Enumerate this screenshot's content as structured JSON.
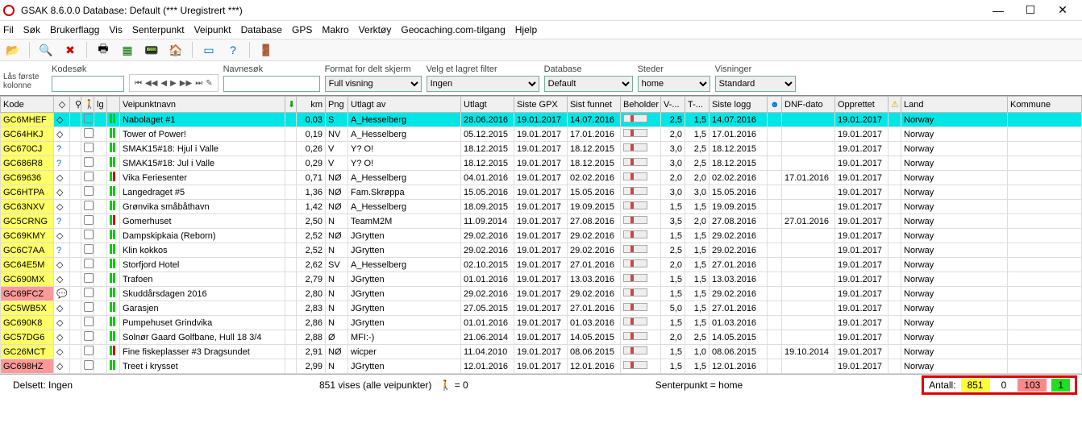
{
  "window": {
    "title": "GSAK 8.6.0.0   Database: Default  (*** Uregistrert ***)"
  },
  "menu": [
    "Fil",
    "Søk",
    "Brukerflagg",
    "Vis",
    "Senterpunkt",
    "Veipunkt",
    "Database",
    "GPS",
    "Makro",
    "Verktøy",
    "Geocaching.com-tilgang",
    "Hjelp"
  ],
  "filters": {
    "lock_col": "Lås første\nkolonne",
    "kodesok_label": "Kodesøk",
    "kodesok_value": "",
    "navnesok_label": "Navnesøk",
    "navnesok_value": "",
    "format_label": "Format for delt skjerm",
    "format_value": "Full visning",
    "filter_label": "Velg et lagret filter",
    "filter_value": "Ingen",
    "database_label": "Database",
    "database_value": "Default",
    "steder_label": "Steder",
    "steder_value": "home",
    "visninger_label": "Visninger",
    "visninger_value": "Standard"
  },
  "columns": [
    "Kode",
    "",
    "",
    "",
    "lg",
    "",
    "Veipunktnavn",
    "",
    "km",
    "Png",
    "Utlagt av",
    "Utlagt",
    "Siste GPX",
    "Sist funnet",
    "Beholder",
    "V-...",
    "T-...",
    "Siste logg",
    "",
    "DNF-dato",
    "Opprettet",
    "",
    "Land",
    "Kommune"
  ],
  "rows": [
    {
      "kode": "GC6MHEF",
      "sel": true,
      "navn": "Nabolaget #1",
      "km": "0,03",
      "png": "S",
      "av": "A_Hesselberg",
      "utlagt": "28.06.2016",
      "gpx": "19.01.2017",
      "funnet": "14.07.2016",
      "v": "2,5",
      "t": "1,5",
      "logg": "14.07.2016",
      "dnf": "",
      "oppr": "19.01.2017",
      "land": "Norway"
    },
    {
      "kode": "GC64HKJ",
      "navn": "Tower of Power!",
      "km": "0,19",
      "png": "NV",
      "av": "A_Hesselberg",
      "utlagt": "05.12.2015",
      "gpx": "19.01.2017",
      "funnet": "17.01.2016",
      "v": "2,0",
      "t": "1,5",
      "logg": "17.01.2016",
      "dnf": "",
      "oppr": "19.01.2017",
      "land": "Norway"
    },
    {
      "kode": "GC670CJ",
      "q": true,
      "navn": "SMAK15#18: Hjul i Valle",
      "km": "0,26",
      "png": "V",
      "av": "Y? O!",
      "utlagt": "18.12.2015",
      "gpx": "19.01.2017",
      "funnet": "18.12.2015",
      "v": "3,0",
      "t": "2,5",
      "logg": "18.12.2015",
      "dnf": "",
      "oppr": "19.01.2017",
      "land": "Norway"
    },
    {
      "kode": "GC686R8",
      "q": true,
      "navn": "SMAK15#18: Jul i Valle",
      "km": "0,29",
      "png": "V",
      "av": "Y? O!",
      "utlagt": "18.12.2015",
      "gpx": "19.01.2017",
      "funnet": "18.12.2015",
      "v": "3,0",
      "t": "2,5",
      "logg": "18.12.2015",
      "dnf": "",
      "oppr": "19.01.2017",
      "land": "Norway"
    },
    {
      "kode": "GC69636",
      "red": false,
      "flagr": true,
      "navn": "Vika Feriesenter",
      "km": "0,71",
      "png": "NØ",
      "av": "A_Hesselberg",
      "utlagt": "04.01.2016",
      "gpx": "19.01.2017",
      "funnet": "02.02.2016",
      "v": "2,0",
      "t": "2,0",
      "logg": "02.02.2016",
      "dnf": "17.01.2016",
      "oppr": "19.01.2017",
      "land": "Norway"
    },
    {
      "kode": "GC6HTPA",
      "navn": "Langedraget #5",
      "km": "1,36",
      "png": "NØ",
      "av": "Fam.Skrøppa",
      "utlagt": "15.05.2016",
      "gpx": "19.01.2017",
      "funnet": "15.05.2016",
      "v": "3,0",
      "t": "3,0",
      "logg": "15.05.2016",
      "dnf": "",
      "oppr": "19.01.2017",
      "land": "Norway"
    },
    {
      "kode": "GC63NXV",
      "navn": "Grønvika småbåthavn",
      "km": "1,42",
      "png": "NØ",
      "av": "A_Hesselberg",
      "utlagt": "18.09.2015",
      "gpx": "19.01.2017",
      "funnet": "19.09.2015",
      "v": "1,5",
      "t": "1,5",
      "logg": "19.09.2015",
      "dnf": "",
      "oppr": "19.01.2017",
      "land": "Norway"
    },
    {
      "kode": "GC5CRNG",
      "q": true,
      "flagr": true,
      "navn": "Gomerhuset",
      "km": "2,50",
      "png": "N",
      "av": "TeamM2M",
      "utlagt": "11.09.2014",
      "gpx": "19.01.2017",
      "funnet": "27.08.2016",
      "v": "3,5",
      "t": "2,0",
      "logg": "27.08.2016",
      "dnf": "27.01.2016",
      "oppr": "19.01.2017",
      "land": "Norway"
    },
    {
      "kode": "GC69KMY",
      "navn": "Dampskipkaia (Reborn)",
      "km": "2,52",
      "png": "NØ",
      "av": "JGrytten",
      "utlagt": "29.02.2016",
      "gpx": "19.01.2017",
      "funnet": "29.02.2016",
      "v": "1,5",
      "t": "1,5",
      "logg": "29.02.2016",
      "dnf": "",
      "oppr": "19.01.2017",
      "land": "Norway"
    },
    {
      "kode": "GC6C7AA",
      "q": true,
      "navn": "Klin kokkos",
      "km": "2,52",
      "png": "N",
      "av": "JGrytten",
      "utlagt": "29.02.2016",
      "gpx": "19.01.2017",
      "funnet": "29.02.2016",
      "v": "2,5",
      "t": "1,5",
      "logg": "29.02.2016",
      "dnf": "",
      "oppr": "19.01.2017",
      "land": "Norway"
    },
    {
      "kode": "GC64E5M",
      "navn": "Storfjord Hotel",
      "km": "2,62",
      "png": "SV",
      "av": "A_Hesselberg",
      "utlagt": "02.10.2015",
      "gpx": "19.01.2017",
      "funnet": "27.01.2016",
      "v": "2,0",
      "t": "1,5",
      "logg": "27.01.2016",
      "dnf": "",
      "oppr": "19.01.2017",
      "land": "Norway"
    },
    {
      "kode": "GC690MX",
      "navn": "Trafoen",
      "km": "2,79",
      "png": "N",
      "av": "JGrytten",
      "utlagt": "01.01.2016",
      "gpx": "19.01.2017",
      "funnet": "13.03.2016",
      "v": "1,5",
      "t": "1,5",
      "logg": "13.03.2016",
      "dnf": "",
      "oppr": "19.01.2017",
      "land": "Norway"
    },
    {
      "kode": "GC69FCZ",
      "red": true,
      "chat": true,
      "navn": "Skuddårsdagen 2016",
      "km": "2,80",
      "png": "N",
      "av": "JGrytten",
      "utlagt": "29.02.2016",
      "gpx": "19.01.2017",
      "funnet": "29.02.2016",
      "v": "1,5",
      "t": "1,5",
      "logg": "29.02.2016",
      "dnf": "",
      "oppr": "19.01.2017",
      "land": "Norway"
    },
    {
      "kode": "GC5WB5X",
      "navn": "Garasjen",
      "km": "2,83",
      "png": "N",
      "av": "JGrytten",
      "utlagt": "27.05.2015",
      "gpx": "19.01.2017",
      "funnet": "27.01.2016",
      "v": "5,0",
      "t": "1,5",
      "logg": "27.01.2016",
      "dnf": "",
      "oppr": "19.01.2017",
      "land": "Norway"
    },
    {
      "kode": "GC690K8",
      "navn": "Pumpehuset Grindvika",
      "km": "2,86",
      "png": "N",
      "av": "JGrytten",
      "utlagt": "01.01.2016",
      "gpx": "19.01.2017",
      "funnet": "01.03.2016",
      "v": "1,5",
      "t": "1,5",
      "logg": "01.03.2016",
      "dnf": "",
      "oppr": "19.01.2017",
      "land": "Norway"
    },
    {
      "kode": "GC57DG6",
      "navn": "Solnør Gaard Golfbane, Hull 18 3/4",
      "km": "2,88",
      "png": "Ø",
      "av": "MFI:-)",
      "utlagt": "21.06.2014",
      "gpx": "19.01.2017",
      "funnet": "14.05.2015",
      "v": "2,0",
      "t": "2,5",
      "logg": "14.05.2015",
      "dnf": "",
      "oppr": "19.01.2017",
      "land": "Norway"
    },
    {
      "kode": "GC26MCT",
      "flagr": true,
      "navn": "Fine fiskeplasser #3 Dragsundet",
      "km": "2,91",
      "png": "NØ",
      "av": "wicper",
      "utlagt": "11.04.2010",
      "gpx": "19.01.2017",
      "funnet": "08.06.2015",
      "v": "1,5",
      "t": "1,0",
      "logg": "08.06.2015",
      "dnf": "19.10.2014",
      "oppr": "19.01.2017",
      "land": "Norway"
    },
    {
      "kode": "GC698HZ",
      "red": true,
      "navn": "Treet i krysset",
      "km": "2,99",
      "png": "N",
      "av": "JGrytten",
      "utlagt": "12.01.2016",
      "gpx": "19.01.2017",
      "funnet": "12.01.2016",
      "v": "1,5",
      "t": "1,5",
      "logg": "12.01.2016",
      "dnf": "",
      "oppr": "19.01.2017",
      "land": "Norway"
    }
  ],
  "status": {
    "delsett": "Delsett: Ingen",
    "vises": "851 vises (alle veipunkter)",
    "person_eq": "= 0",
    "senter": "Senterpunkt = home",
    "antall_label": "Antall:",
    "antall_y": "851",
    "antall_w": "0",
    "antall_p": "103",
    "antall_g": "1"
  }
}
